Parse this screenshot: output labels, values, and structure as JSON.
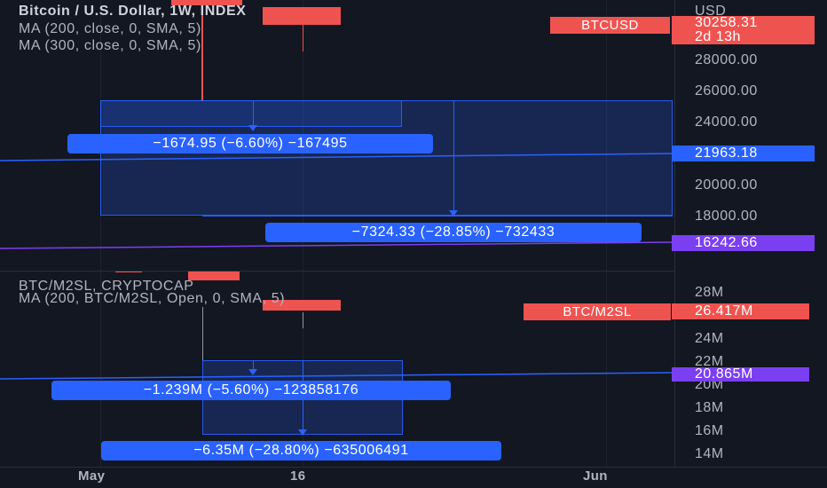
{
  "axis": {
    "currency": "USD"
  },
  "top_pane": {
    "legend": {
      "title": "Bitcoin / U.S. Dollar, 1W, INDEX",
      "ma1": "MA (200, close, 0, SMA, 5)",
      "ma2": "MA (300, close, 0, SMA, 5)"
    },
    "ticks": [
      "28000.00",
      "26000.00",
      "24000.00",
      "20000.00",
      "18000.00"
    ],
    "symbol_badge": "BTCUSD",
    "last_price": "30258.31",
    "countdown": "2d 13h",
    "ma1_value": "21963.18",
    "ma2_value": "16242.66",
    "measure_small": "−1674.95 (−6.60%) −167495",
    "measure_large": "−7324.33 (−28.85%) −732433"
  },
  "bottom_pane": {
    "legend": {
      "title": "BTC/M2SL, CRYPTOCAP",
      "ma1": "MA (200, BTC/M2SL, Open, 0, SMA, 5)"
    },
    "ticks": [
      "28M",
      "24M",
      "22M",
      "20M",
      "18M",
      "16M",
      "14M"
    ],
    "symbol_badge": "BTC/M2SL",
    "last_value": "26.417M",
    "ma_value": "20.865M",
    "measure_small": "−1.239M (−5.60%) −123858176",
    "measure_large": "−6.35M (−28.80%) −635006491"
  },
  "x_axis": {
    "labels": [
      "May",
      "16",
      "Jun"
    ]
  },
  "colors": {
    "background": "#131722",
    "price_red": "#ef5350",
    "measure_blue": "#2962ff",
    "ma1_blue": "#2962ff",
    "ma2_purple": "#7b3ff2"
  }
}
